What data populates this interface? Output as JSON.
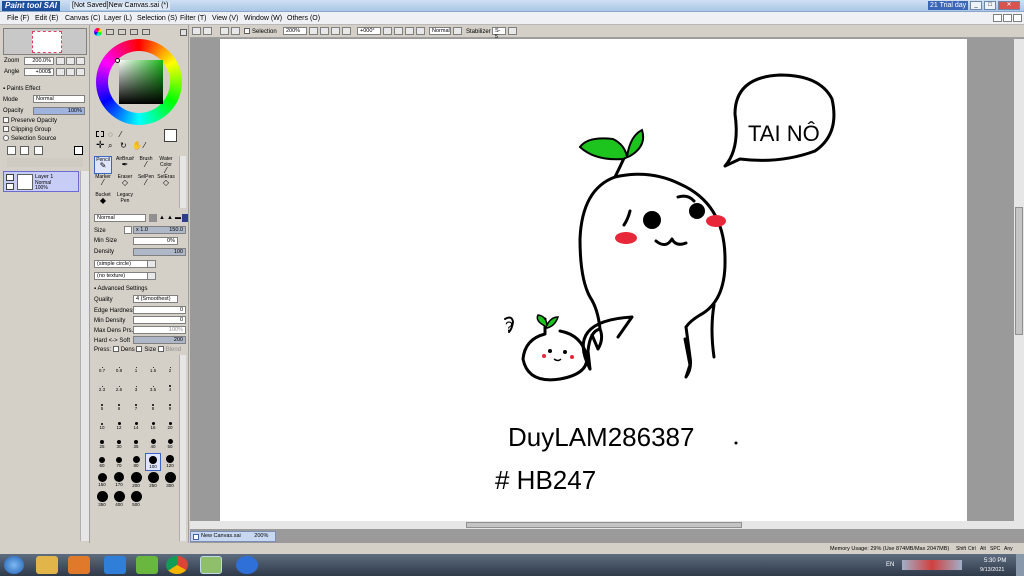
{
  "window": {
    "logo": "Paint tool SAI",
    "title": "[Not Saved]New Canvas.sai (*)",
    "trial": "21 Trial day",
    "btn_min": "_",
    "btn_max": "□",
    "btn_close": "✕"
  },
  "menu": {
    "items": [
      "File (F)",
      "Edit (E)",
      "Canvas (C)",
      "Layer (L)",
      "Selection (S)",
      "Filter (T)",
      "View (V)",
      "Window (W)",
      "Others (O)"
    ]
  },
  "navigator": {
    "zoom_label": "Zoom",
    "zoom_value": "200.0%",
    "angle_label": "Angle",
    "angle_value": "+000$"
  },
  "layer_panel": {
    "paint_effects": "Paints Effect",
    "mode_label": "Mode",
    "mode_value": "Normal",
    "opacity_label": "Opacity",
    "opacity_value": "100%",
    "preserve_opacity": "Preserve Opacity",
    "clipping_group": "Clipping Group",
    "selection_source": "Selection Source",
    "layer_name": "Layer 1",
    "layer_mode": "Normal",
    "layer_opacity": "100%"
  },
  "tools": {
    "row1": [
      "Pencil",
      "AirBrush",
      "Brush",
      "Water Color"
    ],
    "row2": [
      "Marker",
      "Eraser",
      "SelPen",
      "SelEras"
    ],
    "row3": [
      "Bucket",
      "Legacy Pen"
    ]
  },
  "brush_settings": {
    "blend_mode": "Normal",
    "size_label": "Size",
    "size_mult": "x 1.0",
    "size_value": "150.0",
    "min_size_label": "Min Size",
    "min_size_value": "0%",
    "density_label": "Density",
    "density_value": "100",
    "shape": "(simple circle)",
    "texture": "(no texture)",
    "advanced_label": "Advanced Settings",
    "quality_label": "Quality",
    "quality_value": "4 (Smoothest)",
    "edge_label": "Edge Hardness",
    "edge_value": "0",
    "min_density_label": "Min Density",
    "min_density_value": "0",
    "max_dens_label": "Max Dens Prs.",
    "max_dens_value": "100%",
    "hard_soft_label": "Hard <-> Soft",
    "hard_soft_value": "200",
    "press_label": "Press:",
    "press_dens": "Dens",
    "press_size": "Size",
    "press_blend": "Blend"
  },
  "brush_sizes": [
    "0.7",
    "0.8",
    "1",
    "1.5",
    "2",
    "2.3",
    "2.6",
    "3",
    "3.5",
    "4",
    "5",
    "6",
    "7",
    "8",
    "9",
    "10",
    "12",
    "14",
    "16",
    "20",
    "25",
    "30",
    "35",
    "40",
    "50",
    "60",
    "70",
    "80",
    "100",
    "120",
    "150",
    "170",
    "200",
    "250",
    "300",
    "350",
    "400",
    "500"
  ],
  "canvas_toolbar": {
    "selection_label": "Selection",
    "zoom": "200%",
    "rotation": "+000°",
    "blend": "Normal",
    "stabilizer_label": "Stabilizer",
    "stabilizer_value": "S-5"
  },
  "canvas_text": {
    "bubble": "TAI NÔ",
    "question": "?",
    "signature": "DuyLAM286387",
    "hashtag": "# HB247"
  },
  "doc_tab": {
    "name": "New Canvas.sai",
    "zoom": "200%"
  },
  "status": {
    "memory": "Memory Usage: 29% (Use 874MB/Max 2047MB)",
    "keys": [
      "Shift",
      "Ctrl",
      "Alt",
      "SPC",
      "Any"
    ]
  },
  "taskbar": {
    "lang": "EN",
    "time": "5:30 PM",
    "date": "9/13/2021",
    "apps": [
      "start",
      "explorer",
      "media",
      "ie",
      "utorrent",
      "chrome",
      "sai",
      "zalo"
    ]
  },
  "colors": {
    "leaf": "#1ec41e",
    "blush": "#e8283a",
    "accent": "#3b64c8"
  }
}
